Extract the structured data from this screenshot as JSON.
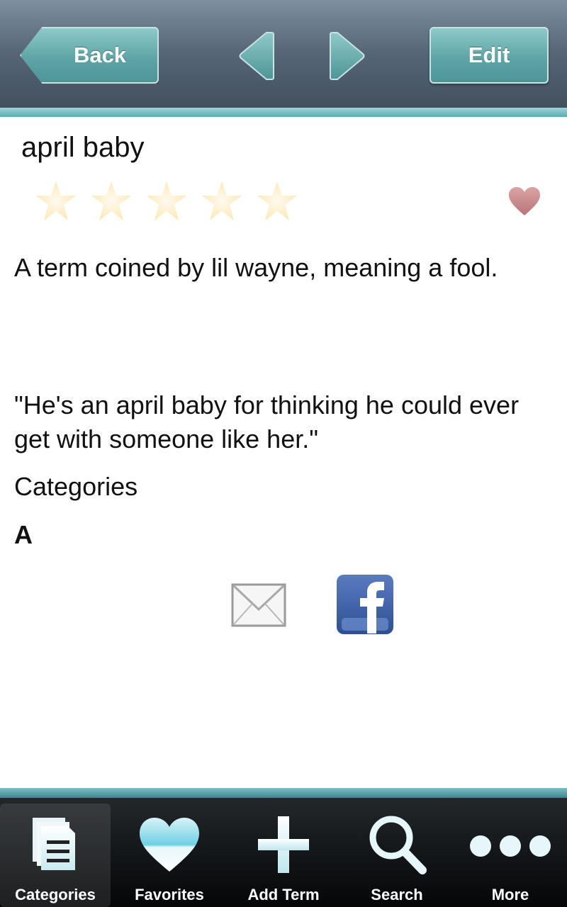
{
  "nav": {
    "back_label": "Back",
    "edit_label": "Edit",
    "prev_icon": "chevron-left-icon",
    "next_icon": "chevron-right-icon"
  },
  "term": {
    "title": "april baby",
    "rating": {
      "value": 0,
      "max": 5
    },
    "favorite_icon": "heart-icon",
    "definition": "A term coined by lil wayne, meaning a fool.",
    "example": "\"He's an april baby for thinking he could ever get with someone like her.\"",
    "categories_heading": "Categories",
    "category_value": "A"
  },
  "share": {
    "mail_icon": "envelope-icon",
    "facebook_icon": "facebook-icon"
  },
  "tabs": [
    {
      "label": "Categories",
      "icon": "document-list-icon",
      "active": true
    },
    {
      "label": "Favorites",
      "icon": "heart-icon",
      "active": false
    },
    {
      "label": "Add Term",
      "icon": "plus-icon",
      "active": false
    },
    {
      "label": "Search",
      "icon": "magnifier-icon",
      "active": false
    },
    {
      "label": "More",
      "icon": "ellipsis-icon",
      "active": false
    }
  ],
  "colors": {
    "accent_teal": "#5fa5a7",
    "star_empty": "#fdf0c6",
    "heart": "#c98a8e",
    "facebook_blue": "#3b5998"
  }
}
